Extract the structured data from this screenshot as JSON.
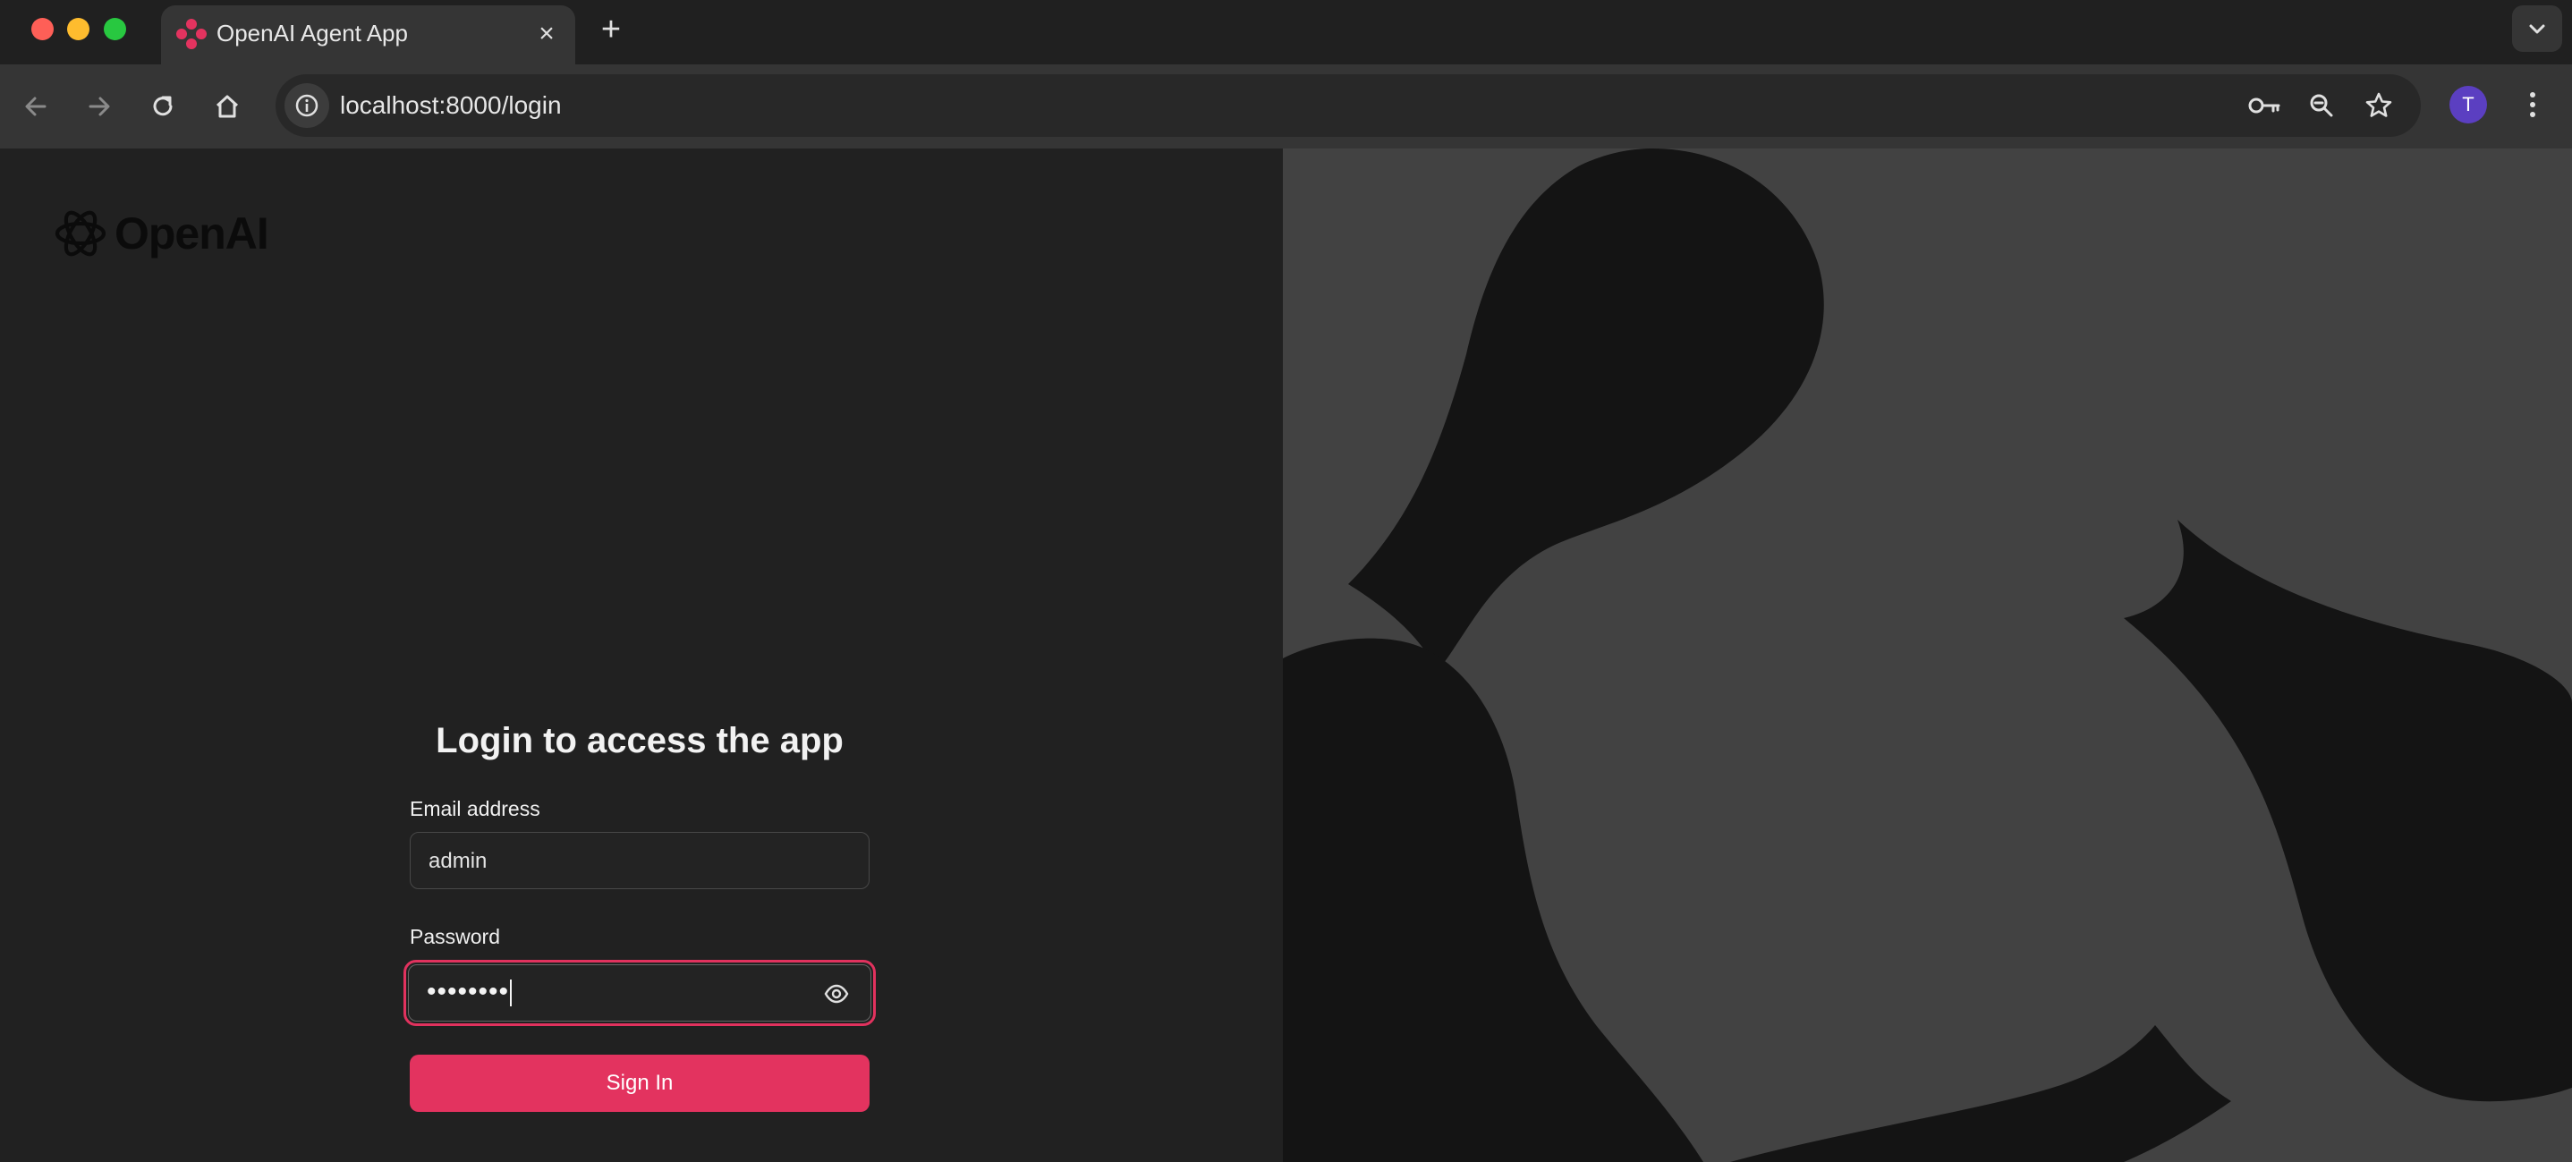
{
  "browser": {
    "tab_title": "OpenAI Agent App",
    "new_tab_symbol": "+",
    "close_symbol": "×",
    "url": "localhost:8000/login",
    "profile_initial": "T",
    "icons": [
      "back-icon",
      "forward-icon",
      "reload-icon",
      "home-icon",
      "site-info-icon",
      "password-key-icon",
      "zoom-icon",
      "bookmark-star-icon",
      "more-menu-icon",
      "tab-search-icon"
    ]
  },
  "brand": {
    "name": "OpenAI"
  },
  "login": {
    "title": "Login to access the app",
    "email_label": "Email address",
    "email_value": "admin",
    "password_label": "Password",
    "password_value": "••••••••",
    "submit_label": "Sign In"
  },
  "colors": {
    "accent": "#e3335f",
    "page_background": "#212121",
    "art_background": "#424242",
    "art_shapes": "#141414",
    "avatar": "#5b3fc1"
  }
}
